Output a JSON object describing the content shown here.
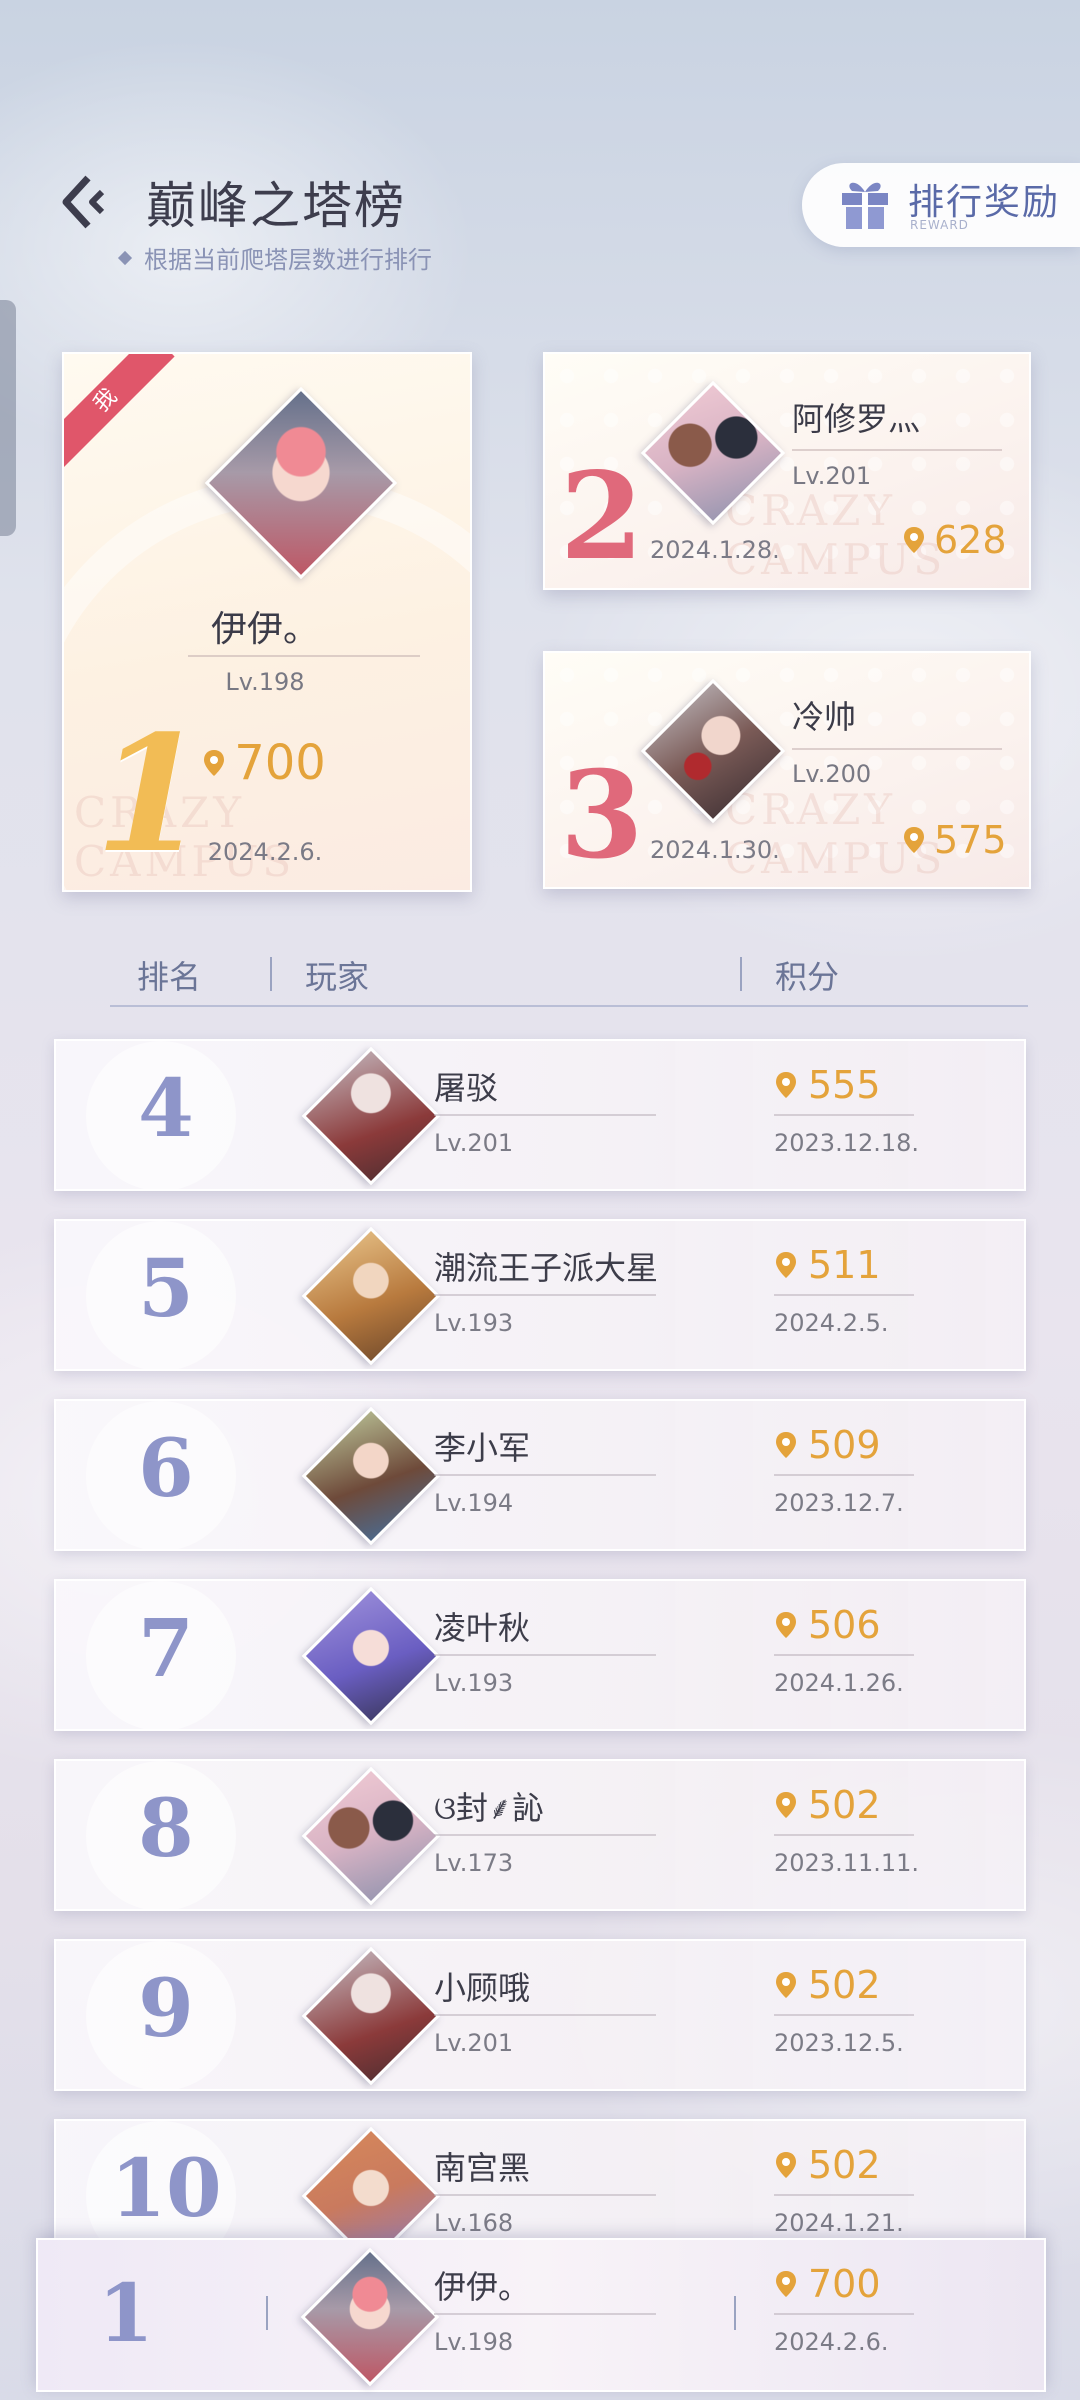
{
  "header": {
    "title": "巅峰之塔榜",
    "subtitle": "根据当前爬塔层数进行排行",
    "reward_label": "排行奖励",
    "reward_sub": "REWARD"
  },
  "podium": [
    {
      "rank": "1",
      "name": "伊伊。",
      "level": "Lv.198",
      "score": "700",
      "date": "2024.2.6.",
      "me_badge": "我"
    },
    {
      "rank": "2",
      "name": "阿修罗灬",
      "level": "Lv.201",
      "score": "628",
      "date": "2024.1.28."
    },
    {
      "rank": "3",
      "name": "冷帅",
      "level": "Lv.200",
      "score": "575",
      "date": "2024.1.30."
    }
  ],
  "watermark": "CRAZY CAMPUS",
  "table_header": {
    "rank": "排名",
    "player": "玩家",
    "score": "积分"
  },
  "rows": [
    {
      "rank": "4",
      "name": "屠驳",
      "level": "Lv.201",
      "score": "555",
      "date": "2023.12.18."
    },
    {
      "rank": "5",
      "name": "潮流王子派大星",
      "level": "Lv.193",
      "score": "511",
      "date": "2024.2.5."
    },
    {
      "rank": "6",
      "name": "李小军",
      "level": "Lv.194",
      "score": "509",
      "date": "2023.12.7."
    },
    {
      "rank": "7",
      "name": "凌叶秋",
      "level": "Lv.193",
      "score": "506",
      "date": "2024.1.26."
    },
    {
      "rank": "8",
      "name": "ଓ封⸙訫",
      "level": "Lv.173",
      "score": "502",
      "date": "2023.11.11."
    },
    {
      "rank": "9",
      "name": "小顾哦",
      "level": "Lv.201",
      "score": "502",
      "date": "2023.12.5."
    },
    {
      "rank": "10",
      "name": "南宫黑",
      "level": "Lv.168",
      "score": "502",
      "date": "2024.1.21."
    }
  ],
  "my_row": {
    "rank": "1",
    "name": "伊伊。",
    "level": "Lv.198",
    "score": "700",
    "date": "2024.2.6."
  },
  "colors": {
    "gold": "#e4a33b",
    "rank_purple": "#8e95c9",
    "podium_rank_red": "#e0697b",
    "podium_one_gold": "#f2bc55"
  },
  "icons": {
    "back": "back-arrow-icon",
    "gift": "gift-icon",
    "score": "map-pin-icon"
  }
}
